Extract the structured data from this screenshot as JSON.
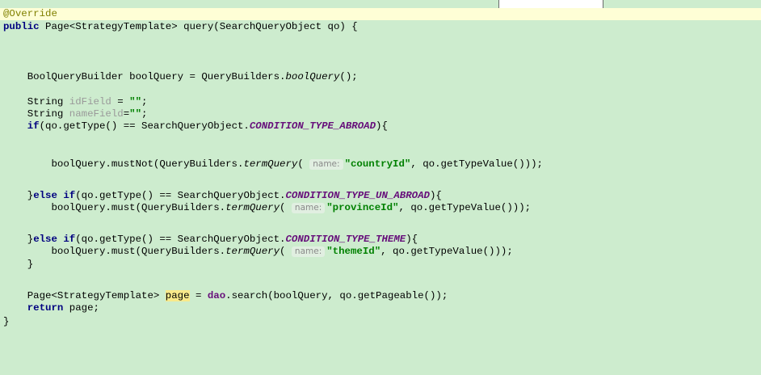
{
  "editor": {
    "line1": {
      "annotation": "@Override"
    },
    "line2": {
      "kw": "public",
      "rest": " Page<StrategyTemplate> query(SearchQueryObject qo) {"
    },
    "line5": {
      "pre": "    BoolQueryBuilder boolQuery = QueryBuilders.",
      "method": "boolQuery",
      "post": "();"
    },
    "line7": {
      "pre": "    String ",
      "field": "idField",
      "post": " = ",
      "str": "\"\"",
      "end": ";"
    },
    "line8": {
      "pre": "    String ",
      "field": "nameField",
      "post": "=",
      "str": "\"\"",
      "end": ";"
    },
    "line9": {
      "indent": "    ",
      "kw": "if",
      "pre": "(qo.getType() == SearchQueryObject.",
      "const": "CONDITION_TYPE_ABROAD",
      "post": "){"
    },
    "line11": {
      "pre": "        boolQuery.mustNot(QueryBuilders.",
      "method": "termQuery",
      "open": "( ",
      "hint": "name:",
      "str": "\"countryId\"",
      "post": ", qo.getTypeValue()));"
    },
    "line13": {
      "pre": "    }",
      "kw1": "else",
      "sp": " ",
      "kw2": "if",
      "mid": "(qo.getType() == SearchQueryObject.",
      "const": "CONDITION_TYPE_UN_ABROAD",
      "post": "){"
    },
    "line14": {
      "pre": "        boolQuery.must(QueryBuilders.",
      "method": "termQuery",
      "open": "( ",
      "hint": "name:",
      "str": "\"provinceId\"",
      "post": ", qo.getTypeValue()));"
    },
    "line16": {
      "pre": "    }",
      "kw1": "else",
      "sp": " ",
      "kw2": "if",
      "mid": "(qo.getType() == SearchQueryObject.",
      "const": "CONDITION_TYPE_THEME",
      "post": "){"
    },
    "line17": {
      "pre": "        boolQuery.must(QueryBuilders.",
      "method": "termQuery",
      "open": "( ",
      "hint": "name:",
      "str": "\"themeId\"",
      "post": ", qo.getTypeValue()));"
    },
    "line18": {
      "text": "    }"
    },
    "line20": {
      "pre": "    Page<StrategyTemplate> ",
      "var": "page",
      "mid": " = ",
      "member": "dao",
      "post": ".search(boolQuery, qo.getPageable());"
    },
    "line21": {
      "indent": "    ",
      "kw": "return",
      "post": " page;"
    },
    "line22": {
      "text": "}"
    }
  }
}
